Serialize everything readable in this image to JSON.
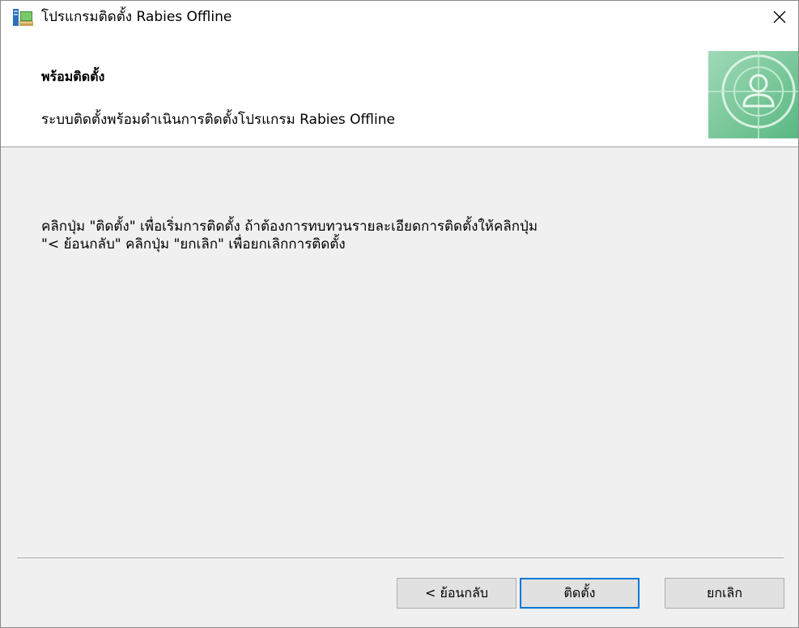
{
  "window": {
    "title": "โปรแกรมติดตั้ง Rabies Offline"
  },
  "banner": {
    "title": "พร้อมติดตั้ง",
    "description": "ระบบติดตั้งพร้อมดำเนินการติดตั้งโปรแกรม Rabies Offline"
  },
  "body": {
    "lines": [
      "คลิกปุ่ม \"ติดตั้ง\" เพื่อเริ่มการติดตั้ง  ถ้าต้องการทบทวนรายละเอียดการติดตั้งให้คลิกปุ่ม",
      "\"< ย้อนกลับ\"  คลิกปุ่ม \"ยกเลิก\" เพื่อยกเลิกการติดตั้ง"
    ]
  },
  "buttons": {
    "back": "< ย้อนกลับ",
    "install": "ติดตั้ง",
    "cancel": "ยกเลิก"
  },
  "icons": {
    "app": "installer-package-icon",
    "close": "close-icon",
    "banner": "user-globe-banner-art"
  },
  "colors": {
    "focus_border": "#0078d7",
    "banner_green": "#7fc9a0"
  }
}
